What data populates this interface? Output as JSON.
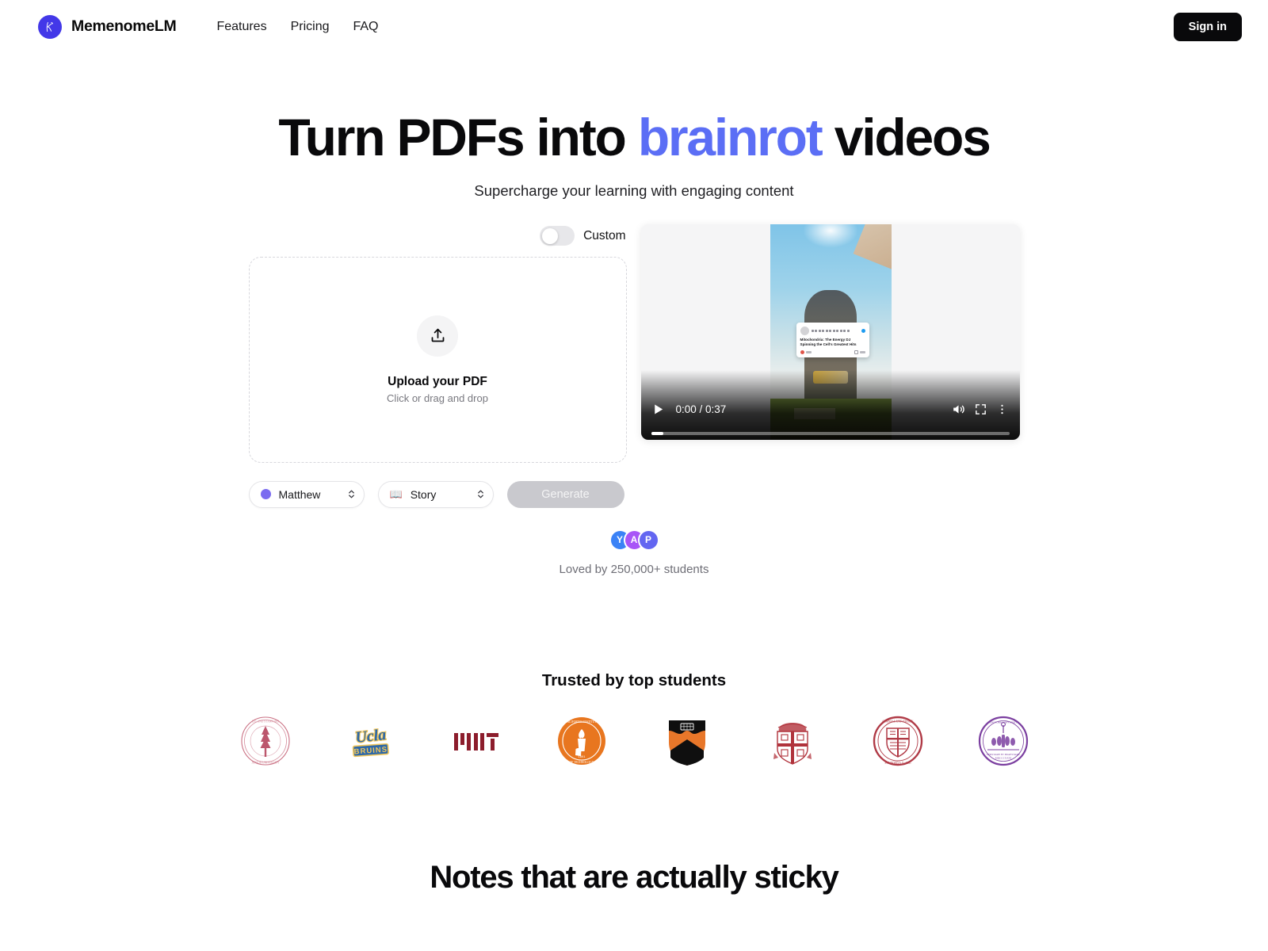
{
  "brand": {
    "name": "MemenomeLM",
    "logo_icon": "script-k-logo-icon",
    "logo_color": "#4338e8"
  },
  "nav": {
    "links": [
      {
        "label": "Features"
      },
      {
        "label": "Pricing"
      },
      {
        "label": "FAQ"
      }
    ],
    "signin_label": "Sign in"
  },
  "hero": {
    "title_part1": "Turn PDFs into",
    "title_accent": "brainrot",
    "title_part2": "videos",
    "accent_color": "#5b6ef5",
    "subtitle": "Supercharge your learning with engaging content"
  },
  "workspace": {
    "custom_toggle": {
      "label": "Custom",
      "state": "off"
    },
    "dropzone": {
      "icon": "upload-icon",
      "title": "Upload your PDF",
      "subtitle": "Click or drag and drop"
    },
    "voice_select": {
      "value": "Matthew",
      "dot_color": "#7b6cf0",
      "stepper_icon": "stepper-up-down-icon"
    },
    "style_select": {
      "emoji": "📖",
      "value": "Story",
      "stepper_icon": "stepper-up-down-icon"
    },
    "generate_button": {
      "label": "Generate",
      "state": "disabled"
    }
  },
  "video": {
    "play_icon": "play-icon",
    "time_display": "0:00 / 0:37",
    "current_time": "0:00",
    "duration": "0:37",
    "mute_icon": "volume-icon",
    "fullscreen_icon": "fullscreen-icon",
    "more_icon": "more-vertical-icon",
    "progress_percent": 0,
    "overlay_tweet": {
      "text": "Mitochondria: The Energy DJ Spinning the Cell's Greatest Hits"
    }
  },
  "social_proof": {
    "avatars": [
      {
        "initial": "Y",
        "color": "#3b82f6"
      },
      {
        "initial": "A",
        "color": "#a855f7"
      },
      {
        "initial": "P",
        "color": "#6366f1"
      }
    ],
    "text": "Loved by 250,000+ students"
  },
  "trusted": {
    "heading": "Trusted by top students",
    "logos": [
      {
        "name": "stanford-logo",
        "label": "Stanford"
      },
      {
        "name": "ucla-logo",
        "label": "UCLA Bruins"
      },
      {
        "name": "mit-logo",
        "label": "MIT"
      },
      {
        "name": "caltech-logo",
        "label": "Caltech"
      },
      {
        "name": "princeton-logo",
        "label": "Princeton"
      },
      {
        "name": "brown-logo",
        "label": "Brown"
      },
      {
        "name": "cornell-logo",
        "label": "Cornell"
      },
      {
        "name": "nyu-logo",
        "label": "NYU"
      }
    ]
  },
  "section_notes": {
    "heading": "Notes that are actually sticky"
  }
}
